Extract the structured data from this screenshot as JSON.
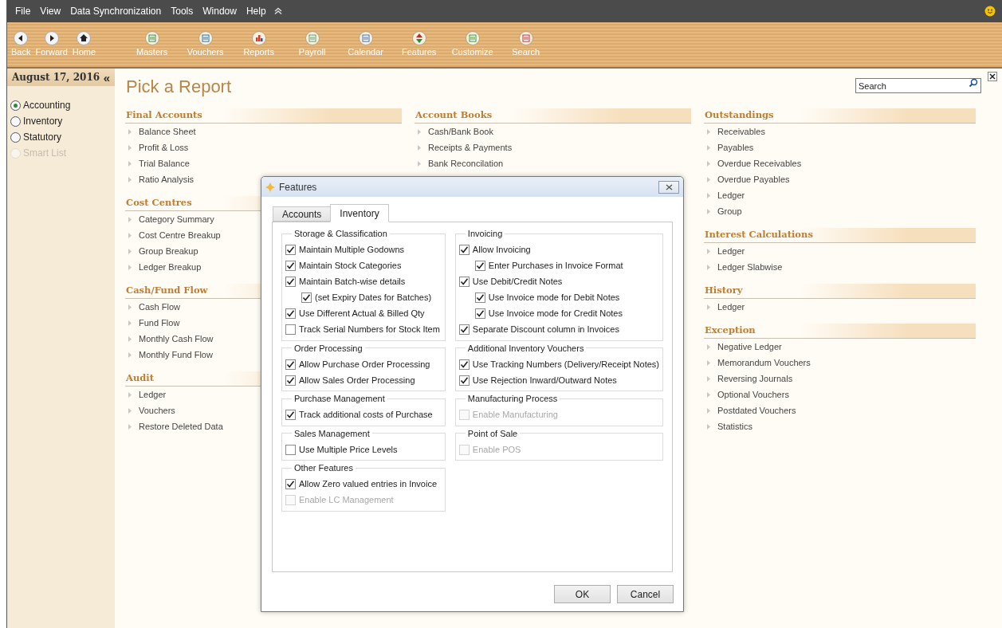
{
  "menu": [
    "File",
    "View",
    "Data Synchronization",
    "Tools",
    "Window",
    "Help"
  ],
  "toolbar": {
    "nav": [
      "Back",
      "Forward",
      "Home"
    ],
    "main": [
      "Masters",
      "Vouchers",
      "Reports",
      "Payroll",
      "Calendar",
      "Features",
      "Customize",
      "Search"
    ]
  },
  "sidebar": {
    "date": "August 17, 2016",
    "collapse": "«",
    "options": [
      {
        "label": "Accounting",
        "selected": true,
        "disabled": false
      },
      {
        "label": "Inventory",
        "selected": false,
        "disabled": false
      },
      {
        "label": "Statutory",
        "selected": false,
        "disabled": false
      },
      {
        "label": "Smart List",
        "selected": false,
        "disabled": true
      }
    ]
  },
  "page": {
    "title": "Pick a Report",
    "search": {
      "placeholder": "Search"
    },
    "columns": [
      [
        {
          "heading": "Final Accounts",
          "items": [
            "Balance Sheet",
            "Profit & Loss",
            "Trial Balance",
            "Ratio Analysis"
          ]
        },
        {
          "heading": "Cost Centres",
          "items": [
            "Category Summary",
            "Cost Centre Breakup",
            "Group Breakup",
            "Ledger Breakup"
          ]
        },
        {
          "heading": "Cash/Fund Flow",
          "items": [
            "Cash Flow",
            "Fund Flow",
            "Monthly Cash Flow",
            "Monthly Fund Flow"
          ]
        },
        {
          "heading": "Audit",
          "items": [
            "Ledger",
            "Vouchers",
            "Restore Deleted Data"
          ]
        }
      ],
      [
        {
          "heading": "Account Books",
          "items": [
            "Cash/Bank Book",
            "Receipts & Payments",
            "Bank Reconcilation"
          ]
        }
      ],
      [
        {
          "heading": "Outstandings",
          "items": [
            "Receivables",
            "Payables",
            "Overdue Receivables",
            "Overdue Payables",
            "Ledger",
            "Group"
          ]
        },
        {
          "heading": "Interest Calculations",
          "items": [
            "Ledger",
            "Ledger Slabwise"
          ]
        },
        {
          "heading": "History",
          "items": [
            "Ledger"
          ]
        },
        {
          "heading": "Exception",
          "items": [
            "Negative Ledger",
            "Memorandum Vouchers",
            "Reversing Journals",
            "Optional Vouchers",
            "Postdated Vouchers",
            "Statistics"
          ]
        }
      ]
    ]
  },
  "dialog": {
    "title": "Features",
    "tabs": [
      {
        "label": "Accounts",
        "selected": false
      },
      {
        "label": "Inventory",
        "selected": true
      }
    ],
    "columns": [
      [
        {
          "title": "Storage & Classification",
          "options": [
            {
              "label": "Maintain Multiple Godowns",
              "checked": true,
              "disabled": false
            },
            {
              "label": "Maintain Stock Categories",
              "checked": true,
              "disabled": false
            },
            {
              "label": "Maintain Batch-wise details",
              "checked": true,
              "disabled": false,
              "children": [
                {
                  "label": "(set Expiry Dates for Batches)",
                  "checked": true,
                  "disabled": false
                }
              ]
            },
            {
              "label": "Use Different Actual & Billed Qty",
              "checked": true,
              "disabled": false
            },
            {
              "label": "Track Serial Numbers for Stock Item",
              "checked": false,
              "disabled": false
            }
          ]
        },
        {
          "title": "Order Processing",
          "options": [
            {
              "label": "Allow Purchase Order Processing",
              "checked": true,
              "disabled": false
            },
            {
              "label": "Allow Sales Order Processing",
              "checked": true,
              "disabled": false
            }
          ]
        },
        {
          "title": "Purchase Management",
          "options": [
            {
              "label": "Track additional costs of Purchase",
              "checked": true,
              "disabled": false
            }
          ]
        },
        {
          "title": "Sales Management",
          "options": [
            {
              "label": "Use Multiple Price Levels",
              "checked": false,
              "disabled": false
            }
          ]
        },
        {
          "title": "Other Features",
          "options": [
            {
              "label": "Allow Zero valued entries in Invoice",
              "checked": true,
              "disabled": false
            },
            {
              "label": "Enable LC Management",
              "checked": false,
              "disabled": true
            }
          ]
        }
      ],
      [
        {
          "title": "Invoicing",
          "options": [
            {
              "label": "Allow Invoicing",
              "checked": true,
              "disabled": false,
              "children": [
                {
                  "label": "Enter Purchases in Invoice Format",
                  "checked": true,
                  "disabled": false
                }
              ]
            },
            {
              "label": "Use Debit/Credit Notes",
              "checked": true,
              "disabled": false,
              "children": [
                {
                  "label": "Use Invoice mode for Debit Notes",
                  "checked": true,
                  "disabled": false
                },
                {
                  "label": "Use Invoice mode for Credit Notes",
                  "checked": true,
                  "disabled": false
                }
              ]
            },
            {
              "label": "Separate Discount column in Invoices",
              "checked": true,
              "disabled": false
            }
          ]
        },
        {
          "title": "Additional Inventory Vouchers",
          "options": [
            {
              "label": "Use Tracking Numbers (Delivery/Receipt Notes)",
              "checked": true,
              "disabled": false
            },
            {
              "label": "Use Rejection Inward/Outward Notes",
              "checked": true,
              "disabled": false
            }
          ]
        },
        {
          "title": "Manufacturing Process",
          "options": [
            {
              "label": "Enable Manufacturing",
              "checked": false,
              "disabled": true
            }
          ]
        },
        {
          "title": "Point of Sale",
          "options": [
            {
              "label": "Enable POS",
              "checked": false,
              "disabled": true
            }
          ]
        }
      ]
    ],
    "buttons": [
      "OK",
      "Cancel"
    ]
  }
}
